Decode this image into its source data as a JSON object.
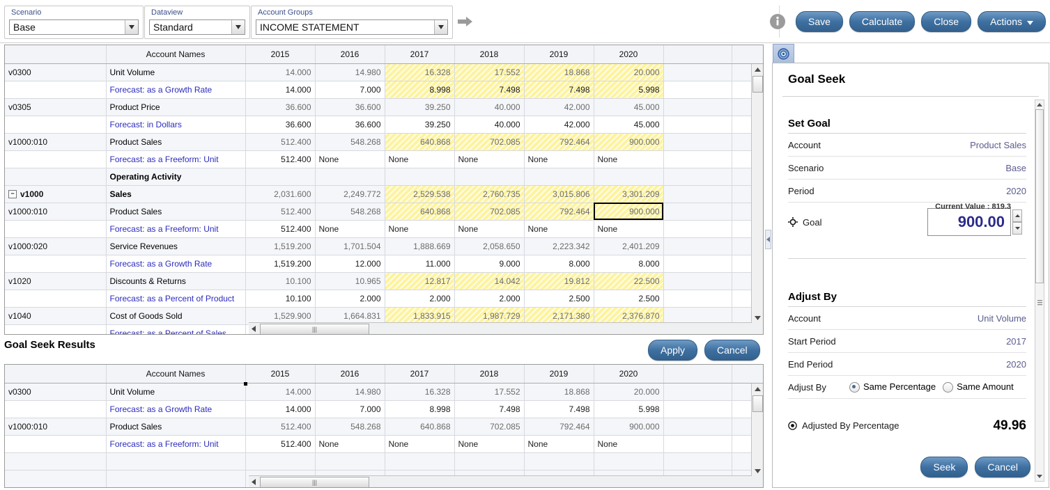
{
  "toolbar": {
    "selectors": [
      {
        "label": "Scenario",
        "value": "Base"
      },
      {
        "label": "Dataview",
        "value": "Standard"
      },
      {
        "label": "Account Groups",
        "value": "INCOME STATEMENT"
      }
    ],
    "go_icon": "right-arrow-icon",
    "info_icon": "info-icon",
    "buttons": [
      {
        "label": "Save",
        "name": "save-button"
      },
      {
        "label": "Calculate",
        "name": "calculate-button"
      },
      {
        "label": "Close",
        "name": "close-button"
      },
      {
        "label": "Actions",
        "name": "actions-button",
        "caret": "▾"
      }
    ]
  },
  "grid": {
    "headers": [
      "",
      "Account Names",
      "2015",
      "2016",
      "2017",
      "2018",
      "2019",
      "2020",
      "",
      ""
    ],
    "rows": [
      {
        "code": "v0300",
        "name": "Unit Volume",
        "type": "account",
        "values": [
          "14.000",
          "14.980",
          "16.328",
          "17.552",
          "18.868",
          "20.000"
        ],
        "hl": [
          false,
          false,
          true,
          true,
          true,
          true
        ]
      },
      {
        "code": "",
        "name": "Forecast: as a Growth Rate",
        "type": "forecast",
        "values": [
          "14.000",
          "7.000",
          "8.998",
          "7.498",
          "7.498",
          "5.998"
        ],
        "hl": [
          false,
          false,
          true,
          true,
          true,
          true
        ]
      },
      {
        "code": "v0305",
        "name": "Product Price",
        "type": "account",
        "values": [
          "36.600",
          "36.600",
          "39.250",
          "40.000",
          "42.000",
          "45.000"
        ],
        "hl": [
          false,
          false,
          false,
          false,
          false,
          false
        ]
      },
      {
        "code": "",
        "name": "Forecast: in Dollars",
        "type": "forecast",
        "values": [
          "36.600",
          "36.600",
          "39.250",
          "40.000",
          "42.000",
          "45.000"
        ],
        "hl": [
          false,
          false,
          false,
          false,
          false,
          false
        ]
      },
      {
        "code": "v1000:010",
        "name": "Product Sales",
        "type": "account",
        "values": [
          "512.400",
          "548.268",
          "640.868",
          "702.085",
          "792.464",
          "900.000"
        ],
        "hl": [
          false,
          false,
          true,
          true,
          true,
          true
        ]
      },
      {
        "code": "",
        "name": "Forecast: as a Freeform: Unit",
        "type": "forecast",
        "values": [
          "512.400",
          "None",
          "None",
          "None",
          "None",
          "None"
        ],
        "hl": [
          false,
          false,
          false,
          false,
          false,
          false
        ]
      },
      {
        "code": "",
        "name": "Operating Activity",
        "type": "section",
        "values": [
          "",
          "",
          "",
          "",
          "",
          ""
        ],
        "hl": [
          false,
          false,
          false,
          false,
          false,
          false
        ]
      },
      {
        "code": "v1000",
        "name": "Sales",
        "type": "total",
        "expander": "⊟",
        "values": [
          "2,031.600",
          "2,249.772",
          "2,529.538",
          "2,760.735",
          "3,015.806",
          "3,301.209"
        ],
        "hl": [
          false,
          false,
          true,
          true,
          true,
          true
        ]
      },
      {
        "code": "v1000:010",
        "name": "Product Sales",
        "type": "account",
        "indent": true,
        "values": [
          "512.400",
          "548.268",
          "640.868",
          "702.085",
          "792.464",
          "900.000"
        ],
        "hl": [
          false,
          false,
          true,
          true,
          true,
          true
        ],
        "selected_index": 5
      },
      {
        "code": "",
        "name": "Forecast: as a Freeform: Unit",
        "type": "forecast",
        "values": [
          "512.400",
          "None",
          "None",
          "None",
          "None",
          "None"
        ],
        "hl": [
          false,
          false,
          false,
          false,
          false,
          false
        ]
      },
      {
        "code": "v1000:020",
        "name": "Service Revenues",
        "type": "account",
        "indent": true,
        "values": [
          "1,519.200",
          "1,701.504",
          "1,888.669",
          "2,058.650",
          "2,223.342",
          "2,401.209"
        ],
        "hl": [
          false,
          false,
          false,
          false,
          false,
          false
        ]
      },
      {
        "code": "",
        "name": "Forecast: as a Growth Rate",
        "type": "forecast",
        "values": [
          "1,519.200",
          "12.000",
          "11.000",
          "9.000",
          "8.000",
          "8.000"
        ],
        "hl": [
          false,
          false,
          false,
          false,
          false,
          false
        ]
      },
      {
        "code": "v1020",
        "name": "Discounts & Returns",
        "type": "account",
        "values": [
          "10.100",
          "10.965",
          "12.817",
          "14.042",
          "19.812",
          "22.500"
        ],
        "hl": [
          false,
          false,
          true,
          true,
          true,
          true
        ]
      },
      {
        "code": "",
        "name": "Forecast: as a Percent of Product",
        "type": "forecast",
        "values": [
          "10.100",
          "2.000",
          "2.000",
          "2.000",
          "2.500",
          "2.500"
        ],
        "hl": [
          false,
          false,
          false,
          false,
          false,
          false
        ]
      },
      {
        "code": "v1040",
        "name": "Cost of Goods Sold",
        "type": "account",
        "values": [
          "1,529.900",
          "1,664.831",
          "1,833.915",
          "1,987.729",
          "2,171.380",
          "2,376.870"
        ],
        "hl": [
          false,
          false,
          true,
          true,
          true,
          true
        ]
      },
      {
        "code": "",
        "name": "Forecast: as a Percent of Sales",
        "type": "forecast",
        "values": [
          "",
          "",
          "",
          "",
          "",
          ""
        ],
        "hl": [
          false,
          false,
          false,
          false,
          false,
          false
        ]
      }
    ]
  },
  "results": {
    "title": "Goal Seek Results",
    "buttons": [
      {
        "label": "Apply",
        "name": "apply-button"
      },
      {
        "label": "Cancel",
        "name": "results-cancel-button"
      }
    ],
    "headers": [
      "",
      "Account Names",
      "2015",
      "2016",
      "2017",
      "2018",
      "2019",
      "2020",
      "",
      ""
    ],
    "rows": [
      {
        "code": "v0300",
        "name": "Unit Volume",
        "type": "account",
        "values": [
          "14.000",
          "14.980",
          "16.328",
          "17.552",
          "18.868",
          "20.000"
        ]
      },
      {
        "code": "",
        "name": "Forecast: as a Growth Rate",
        "type": "forecast",
        "values": [
          "14.000",
          "7.000",
          "8.998",
          "7.498",
          "7.498",
          "5.998"
        ]
      },
      {
        "code": "v1000:010",
        "name": "Product Sales",
        "type": "account",
        "values": [
          "512.400",
          "548.268",
          "640.868",
          "702.085",
          "792.464",
          "900.000"
        ]
      },
      {
        "code": "",
        "name": "Forecast: as a Freeform: Unit",
        "type": "forecast",
        "values": [
          "512.400",
          "None",
          "None",
          "None",
          "None",
          "None"
        ]
      },
      {
        "code": "",
        "name": "",
        "type": "blank",
        "values": [
          "",
          "",
          "",
          "",
          "",
          ""
        ]
      },
      {
        "code": "",
        "name": "",
        "type": "blank",
        "values": [
          "",
          "",
          "",
          "",
          "",
          ""
        ]
      }
    ]
  },
  "goal_seek": {
    "tab_icon": "target-icon",
    "panel_title": "Goal Seek",
    "set_goal": {
      "heading": "Set Goal",
      "rows": [
        {
          "key": "Account",
          "value": "Product Sales"
        },
        {
          "key": "Scenario",
          "value": "Base"
        },
        {
          "key": "Period",
          "value": "2020"
        }
      ],
      "goal_label": "Goal",
      "goal_icon": "target-crosshair-icon",
      "goal_value": "900.00",
      "current_value": "Current Value : 819.3"
    },
    "adjust_by": {
      "heading": "Adjust By",
      "rows": [
        {
          "key": "Account",
          "value": "Unit Volume"
        },
        {
          "key": "Start Period",
          "value": "2017"
        },
        {
          "key": "End Period",
          "value": "2020"
        }
      ],
      "mode_label": "Adjust By",
      "options": [
        {
          "label": "Same Percentage",
          "selected": true
        },
        {
          "label": "Same Amount",
          "selected": false
        }
      ]
    },
    "adjusted": {
      "label": "Adjusted By Percentage",
      "icon": "target-icon",
      "value": "49.96"
    },
    "buttons": [
      {
        "label": "Seek",
        "name": "seek-button"
      },
      {
        "label": "Cancel",
        "name": "goalseek-cancel-button"
      }
    ]
  }
}
